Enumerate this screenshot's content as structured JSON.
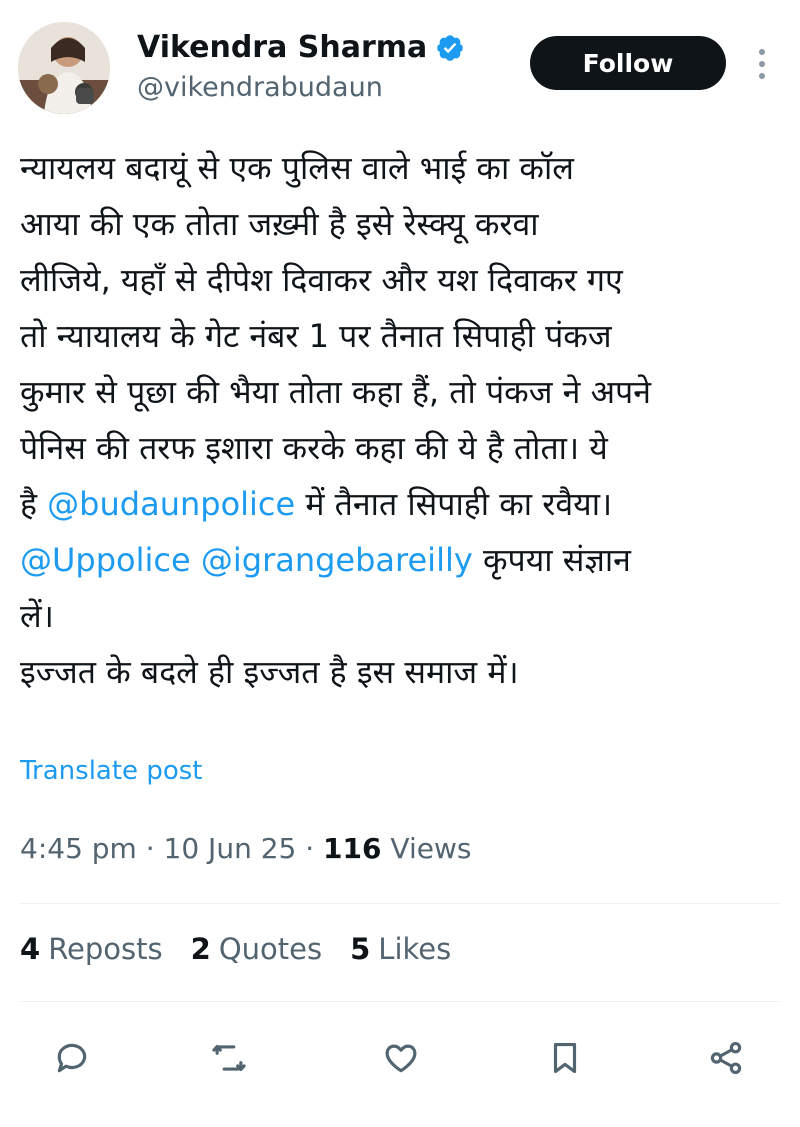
{
  "author": {
    "display_name": "Vikendra Sharma",
    "handle": "@vikendrabudaun",
    "verified": true
  },
  "header": {
    "follow_label": "Follow"
  },
  "post": {
    "lines": [
      [
        {
          "text": "न्यायलय बदायूं से एक पुलिस वाले भाई का कॉल",
          "mention": false
        }
      ],
      [
        {
          "text": "आया की एक तोता जख़्मी है इसे रेस्क्यू करवा",
          "mention": false
        }
      ],
      [
        {
          "text": "लीजिये, यहाँ से दीपेश दिवाकर और यश दिवाकर गए",
          "mention": false
        }
      ],
      [
        {
          "text": "तो न्यायालय के गेट नंबर 1 पर तैनात सिपाही पंकज",
          "mention": false
        }
      ],
      [
        {
          "text": "कुमार से पूछा की भैया तोता कहा हैं, तो पंकज ने अपने",
          "mention": false
        }
      ],
      [
        {
          "text": "पेनिस की तरफ इशारा करके कहा की ये है तोता। ये",
          "mention": false
        }
      ],
      [
        {
          "text": "है ",
          "mention": false
        },
        {
          "text": "@budaunpolice",
          "mention": true
        },
        {
          "text": " में तैनात सिपाही का रवैया।",
          "mention": false
        }
      ],
      [
        {
          "text": "@Uppolice",
          "mention": true
        },
        {
          "text": " ",
          "mention": false
        },
        {
          "text": "@igrangebareilly",
          "mention": true
        },
        {
          "text": " कृपया संज्ञान",
          "mention": false
        }
      ],
      [
        {
          "text": "लें।",
          "mention": false
        }
      ],
      [
        {
          "text": "इज्जत के बदले ही इज्जत है इस समाज में।",
          "mention": false
        }
      ]
    ],
    "translate_label": "Translate post"
  },
  "meta": {
    "time": "4:45 pm",
    "separator": " · ",
    "date": "10 Jun 25",
    "views_count": "116",
    "views_label": " Views"
  },
  "stats": {
    "reposts_count": "4",
    "reposts_label": "Reposts",
    "quotes_count": "2",
    "quotes_label": "Quotes",
    "likes_count": "5",
    "likes_label": "Likes"
  },
  "actions": [
    {
      "name": "reply-icon"
    },
    {
      "name": "repost-icon"
    },
    {
      "name": "like-icon"
    },
    {
      "name": "bookmark-icon"
    },
    {
      "name": "share-icon"
    }
  ],
  "colors": {
    "accent": "#1d9bf0",
    "text": "#0f1419",
    "secondary": "#536471",
    "follow_bg": "#0f1419",
    "divider": "#eff3f4"
  }
}
